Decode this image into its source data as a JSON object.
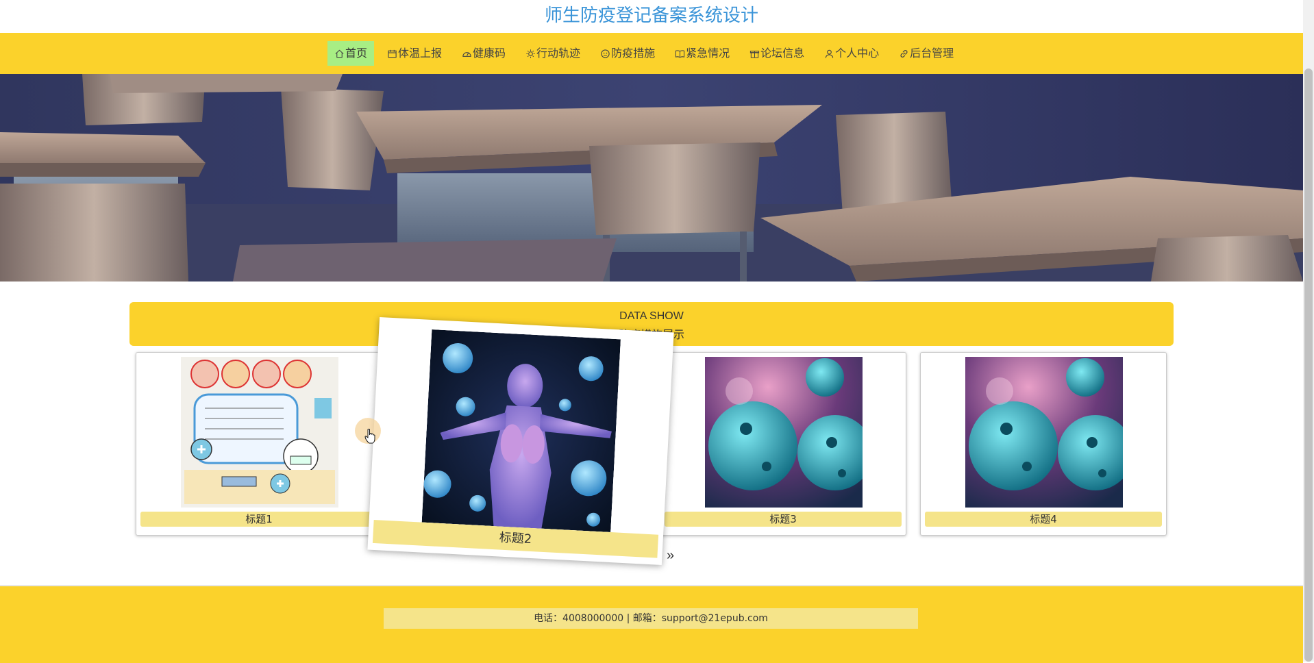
{
  "site": {
    "title": "师生防疫登记备案系统设计"
  },
  "nav": {
    "items": [
      {
        "label": "首页",
        "icon": "home-icon",
        "active": true
      },
      {
        "label": "体温上报",
        "icon": "calendar-icon"
      },
      {
        "label": "健康码",
        "icon": "gauge-icon"
      },
      {
        "label": "行动轨迹",
        "icon": "sun-icon"
      },
      {
        "label": "防疫措施",
        "icon": "face-icon"
      },
      {
        "label": "紧急情况",
        "icon": "book-icon"
      },
      {
        "label": "论坛信息",
        "icon": "gift-icon"
      },
      {
        "label": "个人中心",
        "icon": "user-icon"
      },
      {
        "label": "后台管理",
        "icon": "link-icon"
      }
    ],
    "bg_color": "#fbd22b",
    "active_color": "#a8ee84"
  },
  "banner": {
    "slide_count": 3,
    "active_index": 0
  },
  "data_show": {
    "title_en": "DATA SHOW",
    "title_cn": "防疫措施展示",
    "cards": [
      {
        "caption": "标题1"
      },
      {
        "caption": "标题2"
      },
      {
        "caption": "标题3"
      },
      {
        "caption": "标题4"
      }
    ],
    "next_label": "»"
  },
  "footer": {
    "contact": "电话：4008000000 | 邮箱：support@21epub.com"
  }
}
